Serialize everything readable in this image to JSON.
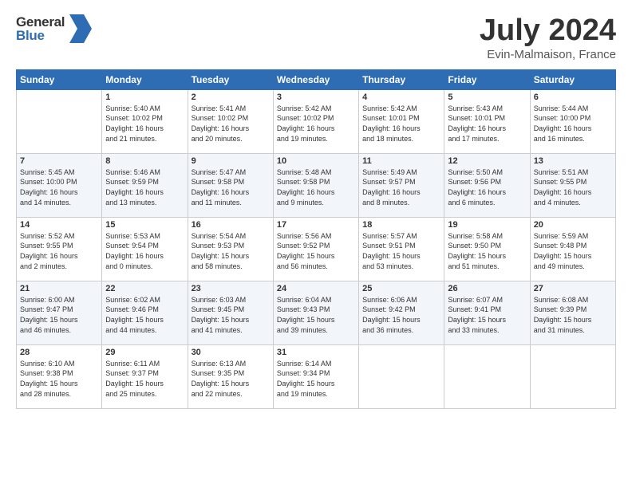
{
  "header": {
    "logo_general": "General",
    "logo_blue": "Blue",
    "month_title": "July 2024",
    "location": "Evin-Malmaison, France"
  },
  "weekdays": [
    "Sunday",
    "Monday",
    "Tuesday",
    "Wednesday",
    "Thursday",
    "Friday",
    "Saturday"
  ],
  "weeks": [
    [
      {
        "day": "",
        "info": ""
      },
      {
        "day": "1",
        "info": "Sunrise: 5:40 AM\nSunset: 10:02 PM\nDaylight: 16 hours\nand 21 minutes."
      },
      {
        "day": "2",
        "info": "Sunrise: 5:41 AM\nSunset: 10:02 PM\nDaylight: 16 hours\nand 20 minutes."
      },
      {
        "day": "3",
        "info": "Sunrise: 5:42 AM\nSunset: 10:02 PM\nDaylight: 16 hours\nand 19 minutes."
      },
      {
        "day": "4",
        "info": "Sunrise: 5:42 AM\nSunset: 10:01 PM\nDaylight: 16 hours\nand 18 minutes."
      },
      {
        "day": "5",
        "info": "Sunrise: 5:43 AM\nSunset: 10:01 PM\nDaylight: 16 hours\nand 17 minutes."
      },
      {
        "day": "6",
        "info": "Sunrise: 5:44 AM\nSunset: 10:00 PM\nDaylight: 16 hours\nand 16 minutes."
      }
    ],
    [
      {
        "day": "7",
        "info": "Sunrise: 5:45 AM\nSunset: 10:00 PM\nDaylight: 16 hours\nand 14 minutes."
      },
      {
        "day": "8",
        "info": "Sunrise: 5:46 AM\nSunset: 9:59 PM\nDaylight: 16 hours\nand 13 minutes."
      },
      {
        "day": "9",
        "info": "Sunrise: 5:47 AM\nSunset: 9:58 PM\nDaylight: 16 hours\nand 11 minutes."
      },
      {
        "day": "10",
        "info": "Sunrise: 5:48 AM\nSunset: 9:58 PM\nDaylight: 16 hours\nand 9 minutes."
      },
      {
        "day": "11",
        "info": "Sunrise: 5:49 AM\nSunset: 9:57 PM\nDaylight: 16 hours\nand 8 minutes."
      },
      {
        "day": "12",
        "info": "Sunrise: 5:50 AM\nSunset: 9:56 PM\nDaylight: 16 hours\nand 6 minutes."
      },
      {
        "day": "13",
        "info": "Sunrise: 5:51 AM\nSunset: 9:55 PM\nDaylight: 16 hours\nand 4 minutes."
      }
    ],
    [
      {
        "day": "14",
        "info": "Sunrise: 5:52 AM\nSunset: 9:55 PM\nDaylight: 16 hours\nand 2 minutes."
      },
      {
        "day": "15",
        "info": "Sunrise: 5:53 AM\nSunset: 9:54 PM\nDaylight: 16 hours\nand 0 minutes."
      },
      {
        "day": "16",
        "info": "Sunrise: 5:54 AM\nSunset: 9:53 PM\nDaylight: 15 hours\nand 58 minutes."
      },
      {
        "day": "17",
        "info": "Sunrise: 5:56 AM\nSunset: 9:52 PM\nDaylight: 15 hours\nand 56 minutes."
      },
      {
        "day": "18",
        "info": "Sunrise: 5:57 AM\nSunset: 9:51 PM\nDaylight: 15 hours\nand 53 minutes."
      },
      {
        "day": "19",
        "info": "Sunrise: 5:58 AM\nSunset: 9:50 PM\nDaylight: 15 hours\nand 51 minutes."
      },
      {
        "day": "20",
        "info": "Sunrise: 5:59 AM\nSunset: 9:48 PM\nDaylight: 15 hours\nand 49 minutes."
      }
    ],
    [
      {
        "day": "21",
        "info": "Sunrise: 6:00 AM\nSunset: 9:47 PM\nDaylight: 15 hours\nand 46 minutes."
      },
      {
        "day": "22",
        "info": "Sunrise: 6:02 AM\nSunset: 9:46 PM\nDaylight: 15 hours\nand 44 minutes."
      },
      {
        "day": "23",
        "info": "Sunrise: 6:03 AM\nSunset: 9:45 PM\nDaylight: 15 hours\nand 41 minutes."
      },
      {
        "day": "24",
        "info": "Sunrise: 6:04 AM\nSunset: 9:43 PM\nDaylight: 15 hours\nand 39 minutes."
      },
      {
        "day": "25",
        "info": "Sunrise: 6:06 AM\nSunset: 9:42 PM\nDaylight: 15 hours\nand 36 minutes."
      },
      {
        "day": "26",
        "info": "Sunrise: 6:07 AM\nSunset: 9:41 PM\nDaylight: 15 hours\nand 33 minutes."
      },
      {
        "day": "27",
        "info": "Sunrise: 6:08 AM\nSunset: 9:39 PM\nDaylight: 15 hours\nand 31 minutes."
      }
    ],
    [
      {
        "day": "28",
        "info": "Sunrise: 6:10 AM\nSunset: 9:38 PM\nDaylight: 15 hours\nand 28 minutes."
      },
      {
        "day": "29",
        "info": "Sunrise: 6:11 AM\nSunset: 9:37 PM\nDaylight: 15 hours\nand 25 minutes."
      },
      {
        "day": "30",
        "info": "Sunrise: 6:13 AM\nSunset: 9:35 PM\nDaylight: 15 hours\nand 22 minutes."
      },
      {
        "day": "31",
        "info": "Sunrise: 6:14 AM\nSunset: 9:34 PM\nDaylight: 15 hours\nand 19 minutes."
      },
      {
        "day": "",
        "info": ""
      },
      {
        "day": "",
        "info": ""
      },
      {
        "day": "",
        "info": ""
      }
    ]
  ]
}
